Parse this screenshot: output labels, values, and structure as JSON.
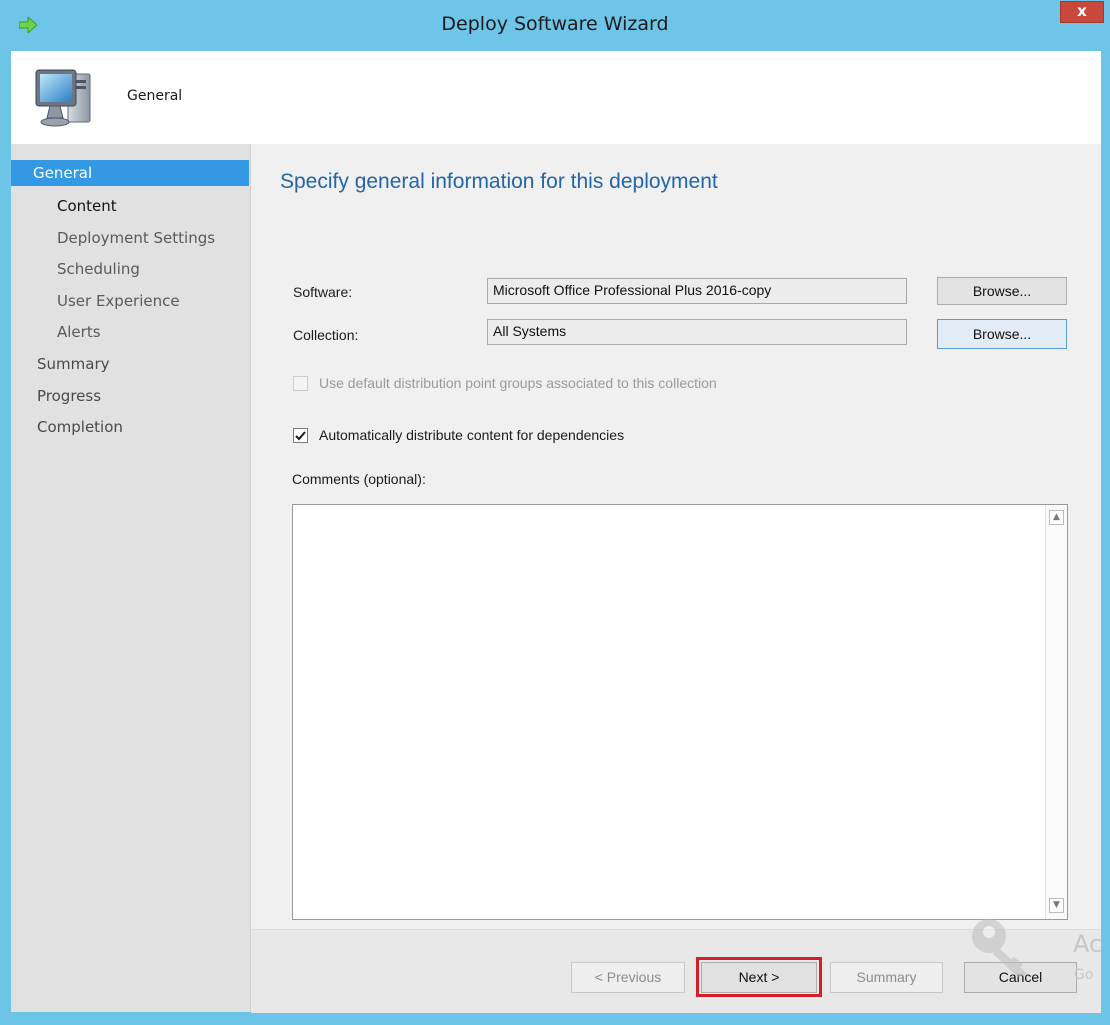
{
  "window": {
    "title": "Deploy Software Wizard",
    "close_label": "x"
  },
  "header": {
    "title": "General"
  },
  "sidebar": {
    "items": [
      {
        "label": "General"
      },
      {
        "label": "Content"
      },
      {
        "label": "Deployment Settings"
      },
      {
        "label": "Scheduling"
      },
      {
        "label": "User Experience"
      },
      {
        "label": "Alerts"
      },
      {
        "label": "Summary"
      },
      {
        "label": "Progress"
      },
      {
        "label": "Completion"
      }
    ]
  },
  "main": {
    "heading": "Specify general information for this deployment",
    "software": {
      "label": "Software:",
      "value": "Microsoft Office Professional Plus 2016-copy",
      "browse_label": "Browse..."
    },
    "collection": {
      "label": "Collection:",
      "value": "All Systems",
      "browse_label": "Browse..."
    },
    "default_dp_groups": {
      "label": "Use default distribution point groups associated to this collection",
      "checked": false,
      "enabled": false
    },
    "auto_distribute": {
      "label": "Automatically distribute content for dependencies",
      "checked": true
    },
    "comments": {
      "label": "Comments (optional):",
      "value": ""
    }
  },
  "footer": {
    "previous_label": "< Previous",
    "next_label": "Next >",
    "summary_label": "Summary",
    "cancel_label": "Cancel"
  },
  "watermark": {
    "line1": "Ac",
    "line2": "Go"
  },
  "colors": {
    "accent": "#3399e5",
    "heading": "#2465a6",
    "titlebar": "#6ec5e8",
    "highlight": "#d21f2a"
  }
}
